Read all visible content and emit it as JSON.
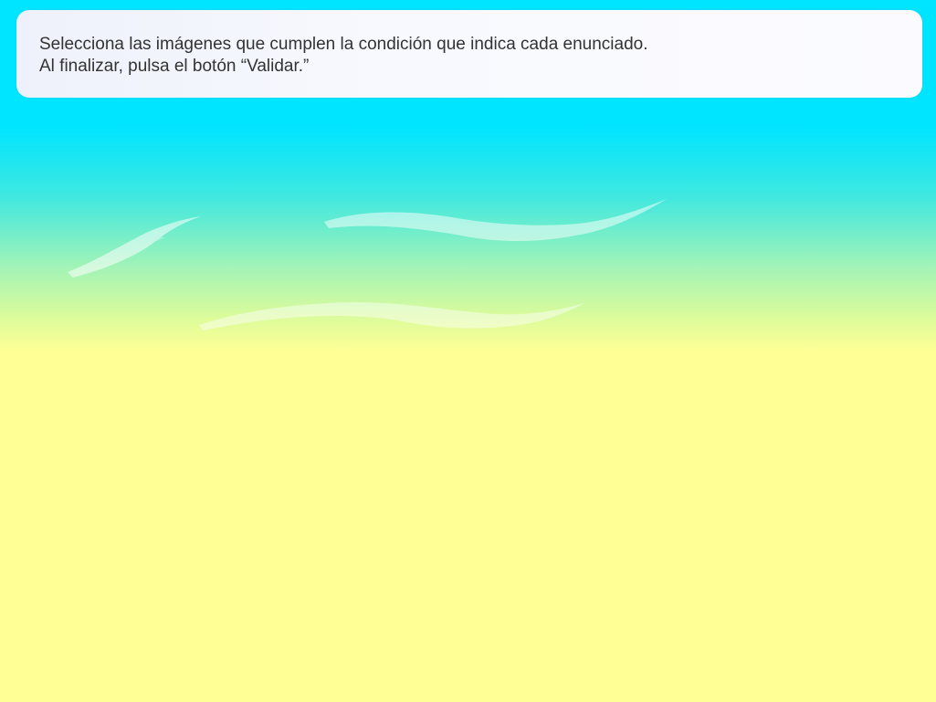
{
  "instructions": {
    "line1": "Selecciona las imágenes que cumplen la condición que indica cada enunciado.",
    "line2": "Al finalizar, pulsa el botón “Validar.”"
  },
  "colors": {
    "sky_top": "#00e5ff",
    "ground": "#ffff95",
    "panel_bg": "#f8f9fe",
    "text": "#333333",
    "cloud_stroke": "#ffffff"
  },
  "decorations": {
    "clouds_icon": "brush-stroke-clouds"
  }
}
